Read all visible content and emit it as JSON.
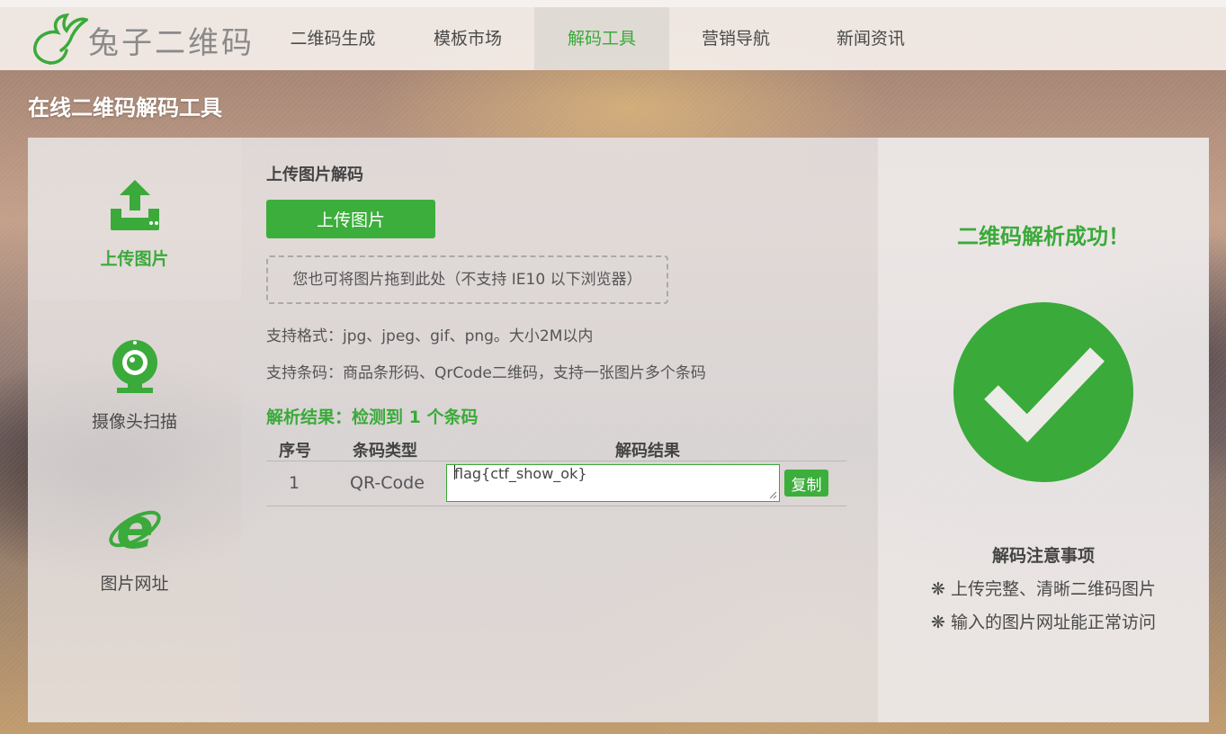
{
  "brand": {
    "name": "兔子二维码",
    "logo_icon": "rabbit-logo",
    "accent_color": "#3cae3c"
  },
  "nav": {
    "items": [
      {
        "label": "二维码生成",
        "active": false
      },
      {
        "label": "模板市场",
        "active": false
      },
      {
        "label": "解码工具",
        "active": true
      },
      {
        "label": "营销导航",
        "active": false
      },
      {
        "label": "新闻资讯",
        "active": false
      }
    ]
  },
  "page_title": "在线二维码解码工具",
  "sidebar": {
    "items": [
      {
        "label": "上传图片",
        "icon": "upload-icon",
        "active": true
      },
      {
        "label": "摄像头扫描",
        "icon": "webcam-icon",
        "active": false
      },
      {
        "label": "图片网址",
        "icon": "ie-browser-icon",
        "active": false
      }
    ]
  },
  "upload": {
    "title": "上传图片解码",
    "button_label": "上传图片",
    "dropzone_text": "您也可将图片拖到此处（不支持 IE10 以下浏览器）",
    "formats_hint": "支持格式：jpg、jpeg、gif、png。大小2M以内",
    "codes_hint": "支持条码：商品条形码、QrCode二维码，支持一张图片多个条码"
  },
  "result": {
    "title": "解析结果：检测到 1 个条码",
    "columns": [
      "序号",
      "条码类型",
      "解码结果"
    ],
    "rows": [
      {
        "index": "1",
        "type": "QR-Code",
        "value": "flag{ctf_show_ok}",
        "copy_label": "复制"
      }
    ]
  },
  "status": {
    "message": "二维码解析成功！",
    "icon": "success-check-icon",
    "notice_title": "解码注意事项",
    "notices": [
      "❋ 上传完整、清晰二维码图片",
      "❋ 输入的图片网址能正常访问"
    ]
  }
}
